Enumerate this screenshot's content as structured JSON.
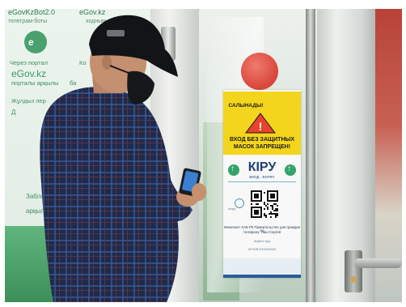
{
  "wall_poster": {
    "header_1": "eGovKzBot2.0",
    "header_2": "телеграм-боты",
    "header_3": "ходным",
    "header_4": "eGov.kz",
    "logo_mark": "e",
    "body_1": "Через портал",
    "body_2": "eGov.kz",
    "body_3": "порталы арқылы",
    "body_4": "Ко",
    "body_5": "ба",
    "body_6": "Жұлдыз пер",
    "body_7": "Д",
    "body_8": "Заблок",
    "body_9": "арқылы"
  },
  "door_sign": {
    "warning_top": "САЛЫНАДЫ!",
    "warning_line_1": "ВХОД БЕЗ ЗАЩИТНЫХ",
    "warning_line_2": "МАСОК ЗАПРЕЩЕН!",
    "title": "КІРУ",
    "subtitle": "ВХОД · ENTRY",
    "qr_side_text": "ashyq",
    "instruction_1": "Мемлекет ХАБ РК Правительство для граждан по",
    "instruction_2": "телефону: Наш Сергей",
    "instruction_3": "Жүйеге кіру",
    "instruction_4": "АРХИВ 0000000000"
  },
  "colors": {
    "sign_yellow": "#f4d51d",
    "sign_blue": "#1f3f75",
    "arrow_green": "#34a36b",
    "egov_green": "#4aa06f",
    "shirt_navy": "#1e2a47"
  },
  "icons": {
    "warning": "warning-triangle-icon",
    "entry_arrow_left": "arrow-up-icon",
    "entry_arrow_right": "arrow-up-icon",
    "arrow_glyph": "↑",
    "warning_glyph": "!"
  }
}
